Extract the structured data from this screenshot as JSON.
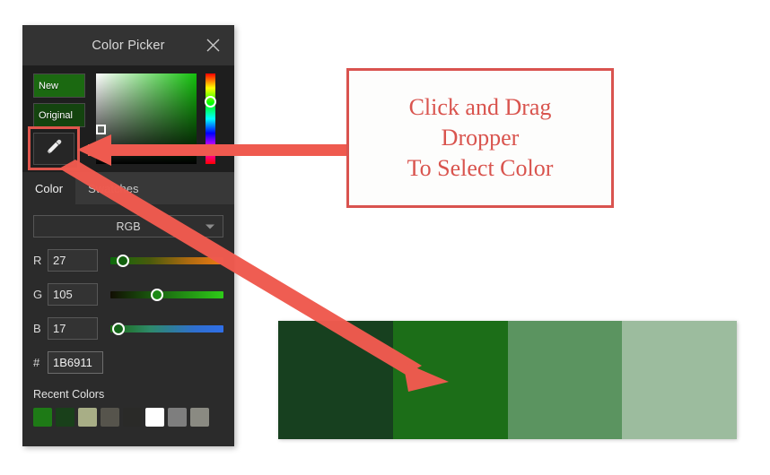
{
  "panel": {
    "title": "Color Picker",
    "close_icon": "close-icon",
    "preview": {
      "new_label": "New",
      "new_color": "#1B6911",
      "original_label": "Original",
      "original_color": "#14440F"
    },
    "dropper": {
      "icon": "eyedropper-icon",
      "highlight_color": "#E0564D"
    },
    "tabs": [
      {
        "label": "Color",
        "active": true
      },
      {
        "label": "Swatches",
        "active": false
      }
    ],
    "mode": {
      "selected": "RGB",
      "chevron_icon": "chevron-down-icon"
    },
    "channels": [
      {
        "label": "R",
        "value": "27"
      },
      {
        "label": "G",
        "value": "105"
      },
      {
        "label": "B",
        "value": "17"
      }
    ],
    "hex": {
      "label": "#",
      "value": "1B6911"
    },
    "recent": {
      "title": "Recent Colors",
      "colors": [
        "#1E7A16",
        "#19401A",
        "#A8AE86",
        "#56544C",
        "#2A2A28",
        "#FFFFFF",
        "#7E7E7E",
        "#8A8A82"
      ]
    }
  },
  "callout": {
    "lines": [
      "Click and Drag",
      "Dropper",
      "To Select Color"
    ],
    "border_color": "#D9534F",
    "text_color": "#D9544E"
  },
  "palette": {
    "colors": [
      "#17401F",
      "#1C6E18",
      "#5B9460",
      "#9CBC9E"
    ]
  },
  "annotations": {
    "arrow_color": "#EF5A4F",
    "horizontal_arrow": "arrow-to-dropper",
    "diagonal_arrow": "arrow-to-palette"
  }
}
